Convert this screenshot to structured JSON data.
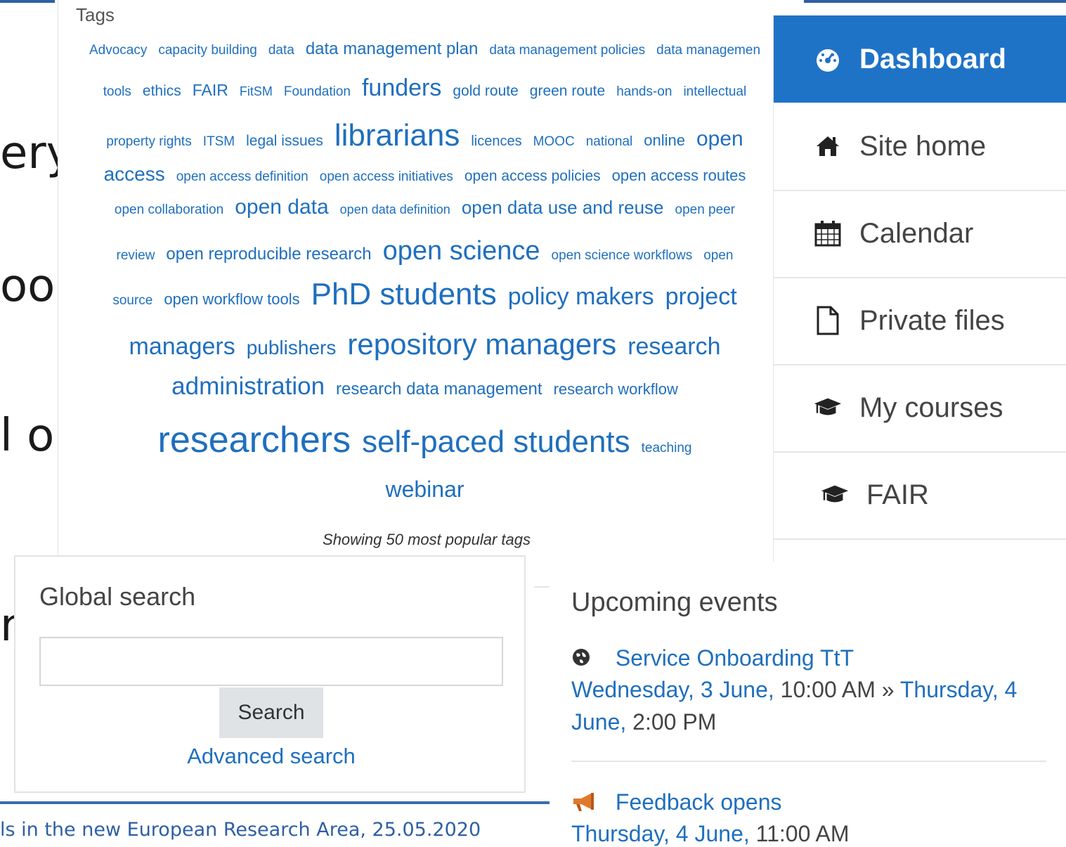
{
  "slide": {
    "words": [
      "ery",
      "ools",
      "l on",
      "ns"
    ],
    "footer": "ls in the new European Research Area, 25.05.2020"
  },
  "tags": {
    "title": "Tags",
    "lines": [
      [
        [
          "Advocacy",
          19
        ],
        [
          "capacity building",
          19
        ],
        [
          "data",
          19
        ],
        [
          "data management plan",
          24
        ],
        [
          "data management policies",
          19
        ],
        [
          "data managemen",
          19
        ]
      ],
      [
        [
          "tools",
          19
        ],
        [
          "ethics",
          21
        ],
        [
          "FAIR",
          23
        ],
        [
          "FitSM",
          18
        ],
        [
          "Foundation",
          19
        ],
        [
          "funders",
          34
        ],
        [
          "gold route",
          21
        ],
        [
          "green route",
          21
        ],
        [
          "hands-on",
          19
        ],
        [
          "intellectual",
          19
        ]
      ],
      [
        [
          "property rights",
          19
        ],
        [
          "ITSM",
          19
        ],
        [
          "legal issues",
          21
        ],
        [
          "librarians",
          44
        ],
        [
          "licences",
          20
        ],
        [
          "MOOC",
          19
        ],
        [
          "national",
          19
        ],
        [
          "online",
          22
        ],
        [
          "open",
          30
        ]
      ],
      [
        [
          "access",
          28
        ],
        [
          "open access definition",
          19
        ],
        [
          "open access initiatives",
          19
        ],
        [
          "open access policies",
          21
        ],
        [
          "open access routes",
          22
        ]
      ],
      [
        [
          "open collaboration",
          19
        ],
        [
          "open data",
          30
        ],
        [
          "open data definition",
          18
        ],
        [
          "open data use and reuse",
          26
        ],
        [
          "open peer",
          19
        ]
      ],
      [
        [
          "review",
          19
        ],
        [
          "open reproducible research",
          24
        ],
        [
          "open science",
          38
        ],
        [
          "open science workflows",
          19
        ],
        [
          "open",
          19
        ]
      ],
      [
        [
          "source",
          19
        ],
        [
          "open workflow tools",
          22
        ],
        [
          "PhD students",
          44
        ],
        [
          "policy makers",
          34
        ],
        [
          "project",
          34
        ]
      ],
      [
        [
          "managers",
          34
        ],
        [
          "publishers",
          28
        ],
        [
          "repository managers",
          42
        ],
        [
          "research",
          34
        ]
      ],
      [
        [
          "administration",
          35
        ],
        [
          "research data management",
          24
        ],
        [
          "research workflow",
          22
        ]
      ],
      [
        [
          "researchers",
          52
        ],
        [
          "self-paced students",
          44
        ],
        [
          "teaching",
          19
        ]
      ],
      [
        [
          "webinar",
          32
        ]
      ]
    ],
    "note": "Showing 50 most popular tags"
  },
  "nav": {
    "items": [
      {
        "label": "Dashboard",
        "icon": "dashboard-icon",
        "active": true
      },
      {
        "label": "Site home",
        "icon": "home-icon"
      },
      {
        "label": "Calendar",
        "icon": "calendar-icon"
      },
      {
        "label": "Private files",
        "icon": "file-icon"
      },
      {
        "label": "My courses",
        "icon": "graduation-cap-icon"
      },
      {
        "label": "FAIR",
        "icon": "graduation-cap-icon"
      }
    ]
  },
  "search": {
    "title": "Global search",
    "input_value": "",
    "button_label": "Search",
    "advanced_link": "Advanced search"
  },
  "events": {
    "title": "Upcoming events",
    "items": [
      {
        "icon": "globe-icon",
        "name": "Service Onboarding TtT",
        "start_date": "Wednesday, 3 June,",
        "start_time": " 10:00 AM » ",
        "end_date_1": "Thursday, 4",
        "end_date_2": "June,",
        "end_time": " 2:00 PM"
      },
      {
        "icon": "megaphone-icon",
        "name": "Feedback opens",
        "date": "Thursday, 4 June,",
        "time": " 11:00 AM"
      }
    ]
  },
  "colors": {
    "accent": "#1f73c7",
    "link": "#1f6fbe",
    "slide_line": "#2e5fa3"
  }
}
